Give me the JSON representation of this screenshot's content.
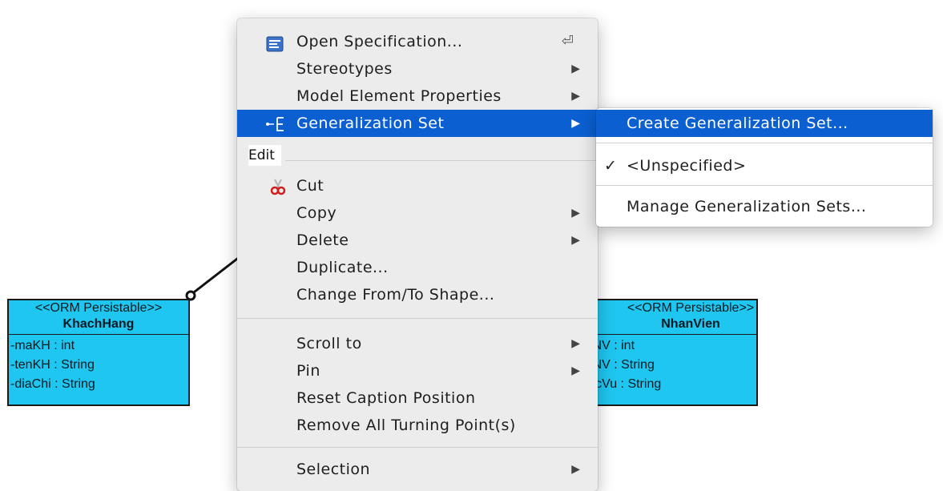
{
  "diagram": {
    "class_left": {
      "stereotype": "<<ORM Persistable>>",
      "name": "KhachHang",
      "attributes": [
        "-maKH : int",
        "-tenKH : String",
        "-diaChi : String"
      ]
    },
    "class_right": {
      "stereotype": "<<ORM Persistable>>",
      "name": "NhanVien",
      "attributes": [
        "-maNV : int",
        "-tenNV : String",
        "-chucVu : String"
      ]
    },
    "colors": {
      "class_fill": "#1fc6f0",
      "border": "#1a1a1a",
      "highlight": "#0b5fd1"
    }
  },
  "context_menu": {
    "open_spec": "Open Specification...",
    "open_spec_shortcut": "⏎",
    "stereotypes": "Stereotypes",
    "model_props": "Model Element Properties",
    "gen_set": "Generalization Set",
    "edit_section": "Edit",
    "cut": "Cut",
    "copy": "Copy",
    "delete": "Delete",
    "duplicate": "Duplicate...",
    "change_shape": "Change From/To Shape...",
    "scroll_to": "Scroll to",
    "pin": "Pin",
    "reset_caption": "Reset Caption Position",
    "remove_turning": "Remove All Turning Point(s)",
    "selection": "Selection"
  },
  "submenu": {
    "create": "Create Generalization Set...",
    "unspecified": "<Unspecified>",
    "manage": "Manage Generalization Sets..."
  }
}
